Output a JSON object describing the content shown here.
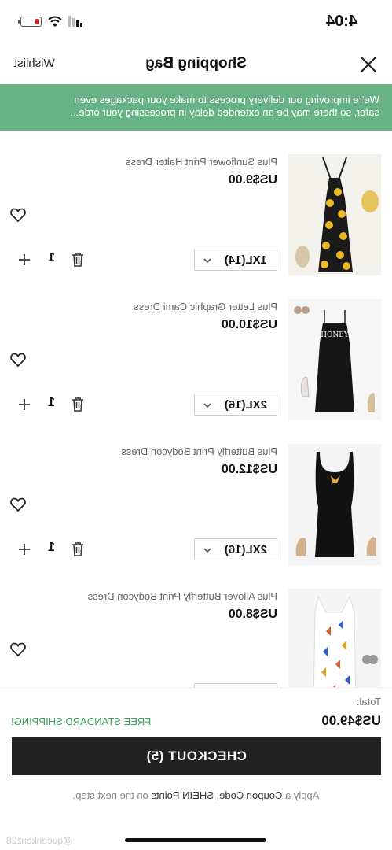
{
  "status": {
    "time": "4:04",
    "battery_color": "#e02020"
  },
  "header": {
    "title": "Shopping Bag",
    "wishlist_label": "Wishlist",
    "close_icon": "close-icon"
  },
  "banner": {
    "line1": "We're improving our delivery process to make your packages even",
    "line2": "safer, so there may be an extended delay in processing your orde...",
    "color": "#68b386"
  },
  "items": [
    {
      "name": "Plus Sunflower Print Halter Dress",
      "price": "US$9.00",
      "size": "1XL(14)",
      "qty": "1"
    },
    {
      "name": "Plus Letter Graphic Cami Dress",
      "price": "US$10.00",
      "size": "2XL(16)",
      "qty": "1",
      "print": "HONEY"
    },
    {
      "name": "Plus Butterfly Print Bodycon Dress",
      "price": "US$12.00",
      "size": "2XL(16)",
      "qty": "1"
    },
    {
      "name": "Plus Allover Butterfly Print Bodycon Dress",
      "price": "US$8.00",
      "size": "",
      "qty": ""
    }
  ],
  "footer": {
    "total_label": "Total:",
    "total_value": "US$49.00",
    "free_shipping": "FREE STANDARD SHIPPING!",
    "checkout_label": "CHECKOUT (5)",
    "coupon_prefix": "Apply a ",
    "coupon_code": "Coupon Code",
    "coupon_sep": ", ",
    "coupon_points": "SHEIN Points",
    "coupon_suffix": " on the next step.",
    "watermark": "@queenkenz28",
    "free_shipping_color": "#3aa05b"
  }
}
